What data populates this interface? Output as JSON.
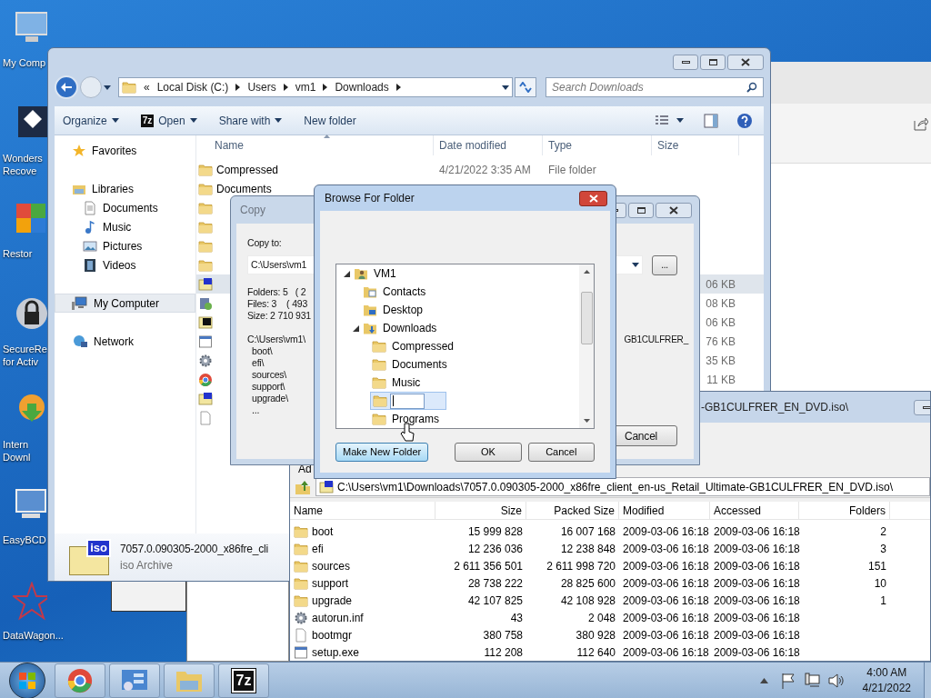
{
  "desktop_icons": [
    {
      "kind": "computer",
      "lines": [
        "My Comp"
      ]
    },
    {
      "kind": "recovery",
      "lines": [
        "Wonders",
        "Recove"
      ]
    },
    {
      "kind": "restore",
      "lines": [
        "Restor"
      ]
    },
    {
      "kind": "lock",
      "lines": [
        "SecureRe",
        "for Activ"
      ]
    },
    {
      "kind": "download",
      "lines": [
        "Intern",
        "Downl"
      ]
    },
    {
      "kind": "monitor",
      "lines": [
        "EasyBCD"
      ]
    },
    {
      "kind": "star",
      "lines": [
        "DataWagon..."
      ]
    }
  ],
  "explorer": {
    "breadcrumbs": [
      "«",
      "Local Disk (C:)",
      "Users",
      "vm1",
      "Downloads"
    ],
    "search": {
      "placeholder": "Search Downloads"
    },
    "toolbar": [
      {
        "label": "Organize",
        "dropdown": true
      },
      {
        "label": "Open",
        "badge": "7z",
        "dropdown": true
      },
      {
        "label": "Share with",
        "dropdown": true
      },
      {
        "label": "New folder",
        "dropdown": false
      }
    ],
    "nav": [
      {
        "kind": "favorites",
        "label": "Favorites",
        "selected": false
      },
      {
        "kind": "libraries",
        "label": "Libraries",
        "selected": false,
        "children": [
          {
            "kind": "documents",
            "label": "Documents",
            "selected": false
          },
          {
            "kind": "music",
            "label": "Music",
            "selected": false
          },
          {
            "kind": "pictures",
            "label": "Pictures",
            "selected": false
          },
          {
            "kind": "videos",
            "label": "Videos",
            "selected": false
          }
        ]
      },
      {
        "kind": "computer",
        "label": "My Computer",
        "selected": true
      },
      {
        "kind": "network",
        "label": "Network",
        "selected": false
      }
    ],
    "columns": [
      "Name",
      "Date modified",
      "Type",
      "Size"
    ],
    "rows": [
      {
        "kind": "folder",
        "name": "Compressed",
        "date": "4/21/2022 3:35 AM",
        "type": "File folder",
        "selected": false
      },
      {
        "kind": "folder",
        "name": "Documents",
        "selected": false
      },
      {
        "kind": "folder",
        "selected": false
      },
      {
        "kind": "folder",
        "selected": false
      },
      {
        "kind": "folder",
        "selected": false
      },
      {
        "kind": "folder",
        "selected": false
      },
      {
        "kind": "iso",
        "size": "06 KB",
        "selected": true
      },
      {
        "kind": "installer",
        "size": "08 KB",
        "selected": false
      },
      {
        "kind": "archive",
        "size": "06 KB",
        "selected": false
      },
      {
        "kind": "exe",
        "size": "76 KB",
        "selected": false
      },
      {
        "kind": "gear",
        "size": "35 KB",
        "selected": false
      },
      {
        "kind": "chrome",
        "size": "11 KB",
        "selected": false
      },
      {
        "kind": "iso",
        "selected": false
      },
      {
        "kind": "file",
        "selected": false
      }
    ],
    "details": {
      "name": "7057.0.090305-2000_x86fre_cli",
      "type": "iso Archive",
      "icon_text": "iso"
    }
  },
  "copy_dialog": {
    "title": "Copy",
    "label": "Copy to:",
    "path_value": "C:\\Users\\vm1",
    "browse": "...",
    "info": [
      "Folders: 5   ( 2",
      "Files: 3    ( 493",
      "Size: 2 710 931"
    ],
    "items": [
      "C:\\Users\\vm1\\",
      "boot\\",
      "efi\\",
      "sources\\",
      "support\\",
      "upgrade\\",
      "..."
    ],
    "item_tail": "GB1CULFRER_",
    "cancel": "Cancel"
  },
  "browse_dialog": {
    "title": "Browse For Folder",
    "tree": [
      {
        "kind": "user",
        "label": "VM1",
        "expanded": true,
        "selected": false,
        "children": [
          {
            "kind": "contacts",
            "label": "Contacts",
            "selected": false
          },
          {
            "kind": "desktop",
            "label": "Desktop",
            "selected": false
          },
          {
            "kind": "downloads",
            "label": "Downloads",
            "expanded": true,
            "selected": false,
            "children": [
              {
                "kind": "folder",
                "label": "Compressed",
                "selected": false
              },
              {
                "kind": "folder",
                "label": "Documents",
                "selected": false
              },
              {
                "kind": "folder",
                "label": "Music",
                "selected": false
              },
              {
                "kind": "edit",
                "selected": true
              },
              {
                "kind": "folder",
                "label": "Programs",
                "selected": false
              }
            ]
          }
        ]
      }
    ],
    "buttons": [
      {
        "label": "Make New Folder",
        "focused": true
      },
      {
        "label": "OK",
        "focused": false
      },
      {
        "label": "Cancel",
        "focused": false
      }
    ]
  },
  "sevenzip": {
    "title_tail": "-GB1CULFRER_EN_DVD.iso\\",
    "toolbar_tail": "Ad",
    "path": "C:\\Users\\vm1\\Downloads\\7057.0.090305-2000_x86fre_client_en-us_Retail_Ultimate-GB1CULFRER_EN_DVD.iso\\",
    "columns": [
      "Name",
      "Size",
      "Packed Size",
      "Modified",
      "Accessed",
      "Folders"
    ],
    "rows": [
      {
        "kind": "folder",
        "name": "boot",
        "size": "15 999 828",
        "packed": "16 007 168",
        "modified": "2009-03-06 16:18",
        "accessed": "2009-03-06 16:18",
        "folders": "2"
      },
      {
        "kind": "folder",
        "name": "efi",
        "size": "12 236 036",
        "packed": "12 238 848",
        "modified": "2009-03-06 16:18",
        "accessed": "2009-03-06 16:18",
        "folders": "3"
      },
      {
        "kind": "folder",
        "name": "sources",
        "size": "2 611 356 501",
        "packed": "2 611 998 720",
        "modified": "2009-03-06 16:18",
        "accessed": "2009-03-06 16:18",
        "folders": "151"
      },
      {
        "kind": "folder",
        "name": "support",
        "size": "28 738 222",
        "packed": "28 825 600",
        "modified": "2009-03-06 16:18",
        "accessed": "2009-03-06 16:18",
        "folders": "10"
      },
      {
        "kind": "folder",
        "name": "upgrade",
        "size": "42 107 825",
        "packed": "42 108 928",
        "modified": "2009-03-06 16:18",
        "accessed": "2009-03-06 16:18",
        "folders": "1"
      },
      {
        "kind": "gear",
        "name": "autorun.inf",
        "size": "43",
        "packed": "2 048",
        "modified": "2009-03-06 16:18",
        "accessed": "2009-03-06 16:18"
      },
      {
        "kind": "file",
        "name": "bootmgr",
        "size": "380 758",
        "packed": "380 928",
        "modified": "2009-03-06 16:18",
        "accessed": "2009-03-06 16:18"
      },
      {
        "kind": "exe",
        "name": "setup.exe",
        "size": "112 208",
        "packed": "112 640",
        "modified": "2009-03-06 16:18",
        "accessed": "2009-03-06 16:18"
      }
    ]
  },
  "taskbar": {
    "apps": [
      {
        "kind": "chrome"
      },
      {
        "kind": "panel"
      },
      {
        "kind": "explorer"
      },
      {
        "kind": "archive",
        "badge": "7z"
      }
    ],
    "time": "4:00 AM",
    "date": "4/21/2022"
  }
}
